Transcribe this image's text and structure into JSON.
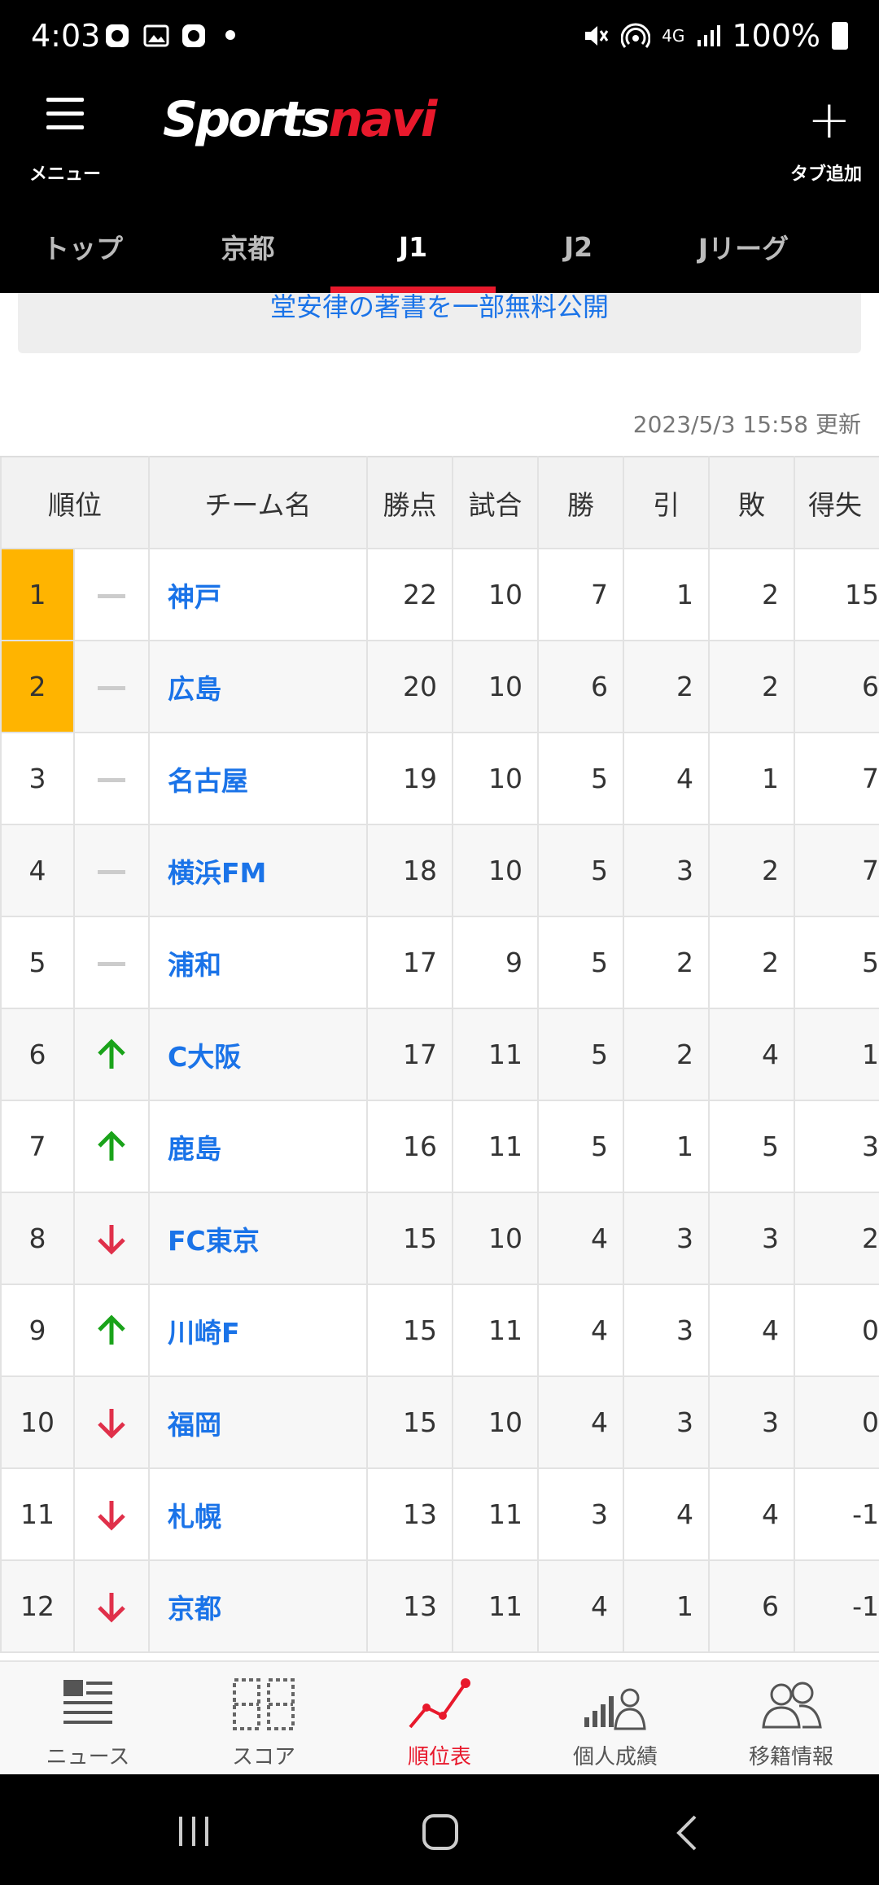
{
  "status_bar": {
    "time": "4:03",
    "network": "4G",
    "battery": "100%"
  },
  "header": {
    "menu_label": "メニュー",
    "logo_white": "Sports",
    "logo_red": "navi",
    "add_tab_label": "タブ追加"
  },
  "tabs": [
    {
      "label": "トップ"
    },
    {
      "label": "京都"
    },
    {
      "label": "J1",
      "active": true
    },
    {
      "label": "J2"
    },
    {
      "label": "Jリーグ"
    }
  ],
  "banner_text": "堂安律の著書を一部無料公開",
  "updated": "2023/5/3 15:58 更新",
  "table": {
    "headers": {
      "rank": "順位",
      "team": "チーム名",
      "pts": "勝点",
      "played": "試合",
      "win": "勝",
      "draw": "引",
      "loss": "敗",
      "gd": "得失"
    },
    "rows": [
      {
        "rank": "1",
        "move": "same",
        "team": "神戸",
        "pts": "22",
        "played": "10",
        "win": "7",
        "draw": "1",
        "loss": "2",
        "gd": "15"
      },
      {
        "rank": "2",
        "move": "same",
        "team": "広島",
        "pts": "20",
        "played": "10",
        "win": "6",
        "draw": "2",
        "loss": "2",
        "gd": "6"
      },
      {
        "rank": "3",
        "move": "same",
        "team": "名古屋",
        "pts": "19",
        "played": "10",
        "win": "5",
        "draw": "4",
        "loss": "1",
        "gd": "7"
      },
      {
        "rank": "4",
        "move": "same",
        "team": "横浜FM",
        "pts": "18",
        "played": "10",
        "win": "5",
        "draw": "3",
        "loss": "2",
        "gd": "7"
      },
      {
        "rank": "5",
        "move": "same",
        "team": "浦和",
        "pts": "17",
        "played": "9",
        "win": "5",
        "draw": "2",
        "loss": "2",
        "gd": "5"
      },
      {
        "rank": "6",
        "move": "up",
        "team": "C大阪",
        "pts": "17",
        "played": "11",
        "win": "5",
        "draw": "2",
        "loss": "4",
        "gd": "1"
      },
      {
        "rank": "7",
        "move": "up",
        "team": "鹿島",
        "pts": "16",
        "played": "11",
        "win": "5",
        "draw": "1",
        "loss": "5",
        "gd": "3"
      },
      {
        "rank": "8",
        "move": "down",
        "team": "FC東京",
        "pts": "15",
        "played": "10",
        "win": "4",
        "draw": "3",
        "loss": "3",
        "gd": "2"
      },
      {
        "rank": "9",
        "move": "up",
        "team": "川崎F",
        "pts": "15",
        "played": "11",
        "win": "4",
        "draw": "3",
        "loss": "4",
        "gd": "0"
      },
      {
        "rank": "10",
        "move": "down",
        "team": "福岡",
        "pts": "15",
        "played": "10",
        "win": "4",
        "draw": "3",
        "loss": "3",
        "gd": "0"
      },
      {
        "rank": "11",
        "move": "down",
        "team": "札幌",
        "pts": "13",
        "played": "11",
        "win": "3",
        "draw": "4",
        "loss": "4",
        "gd": "-1"
      },
      {
        "rank": "12",
        "move": "down",
        "team": "京都",
        "pts": "13",
        "played": "11",
        "win": "4",
        "draw": "1",
        "loss": "6",
        "gd": "-1"
      }
    ]
  },
  "bottom_nav": [
    {
      "label": "ニュース",
      "icon": "news-icon"
    },
    {
      "label": "スコア",
      "icon": "score-icon"
    },
    {
      "label": "順位表",
      "icon": "standings-icon",
      "active": true
    },
    {
      "label": "個人成績",
      "icon": "stats-icon"
    },
    {
      "label": "移籍情報",
      "icon": "transfer-icon"
    }
  ],
  "colors": {
    "accent": "#e8192c",
    "link": "#1a73e8",
    "highlight": "#ffb400",
    "up": "#1aa31a",
    "down": "#e0304a"
  }
}
